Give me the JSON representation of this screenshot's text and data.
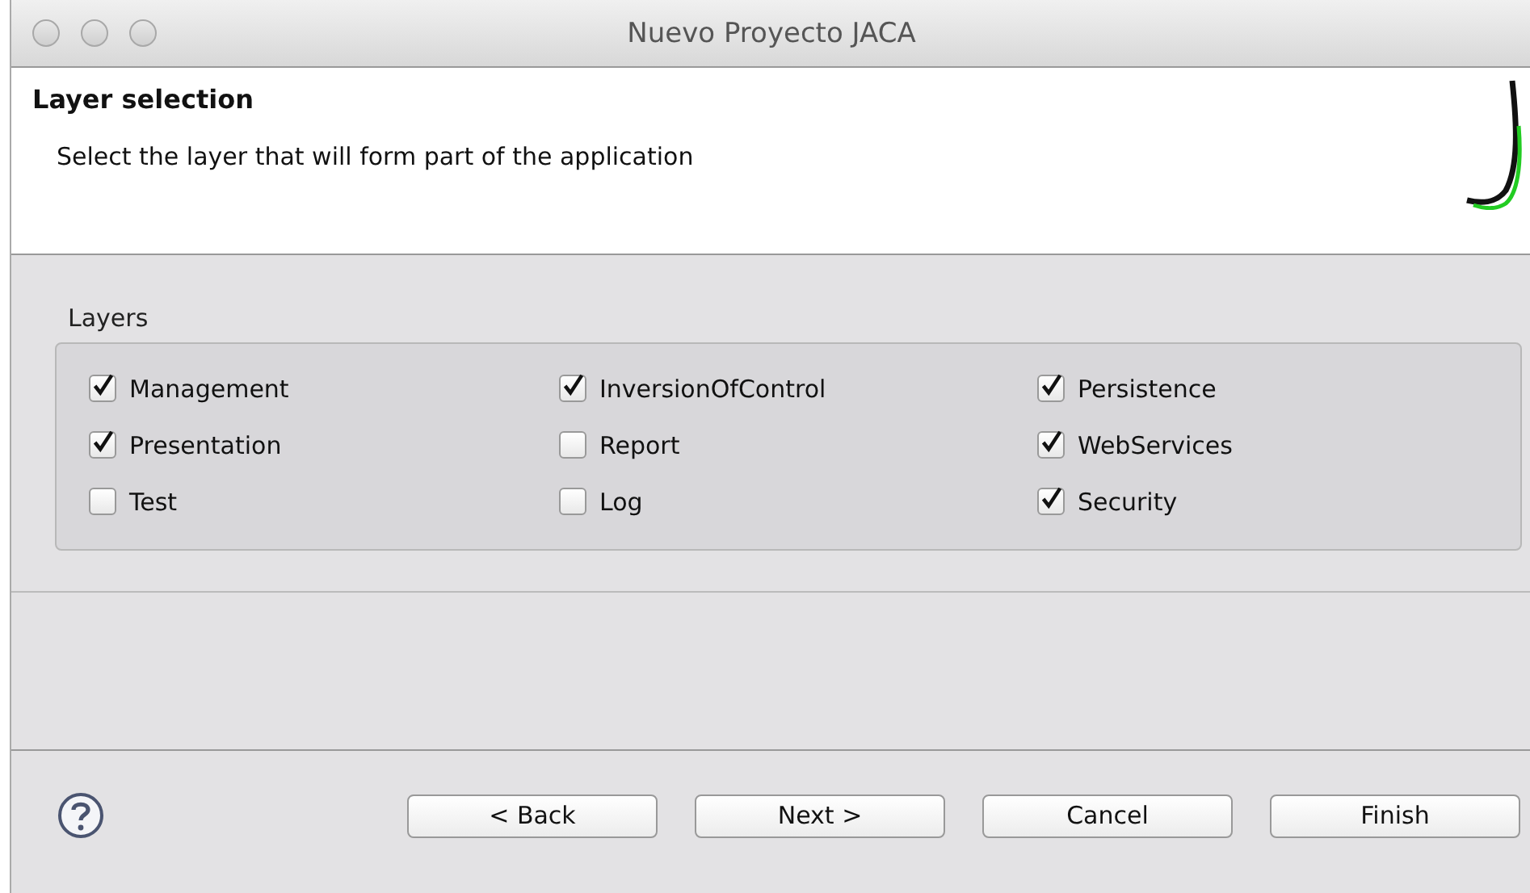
{
  "window": {
    "title": "Nuevo Proyecto JACA"
  },
  "header": {
    "title": "Layer selection",
    "description": "Select the layer that will form part of the application"
  },
  "layers": {
    "label": "Layers",
    "items": [
      {
        "label": "Management",
        "checked": true
      },
      {
        "label": "InversionOfControl",
        "checked": true
      },
      {
        "label": "Persistence",
        "checked": true
      },
      {
        "label": "Presentation",
        "checked": true
      },
      {
        "label": "Report",
        "checked": false
      },
      {
        "label": "WebServices",
        "checked": true
      },
      {
        "label": "Test",
        "checked": false
      },
      {
        "label": "Log",
        "checked": false
      },
      {
        "label": "Security",
        "checked": true
      }
    ]
  },
  "buttons": [
    "< Back",
    "Next >",
    "Cancel",
    "Finish"
  ]
}
